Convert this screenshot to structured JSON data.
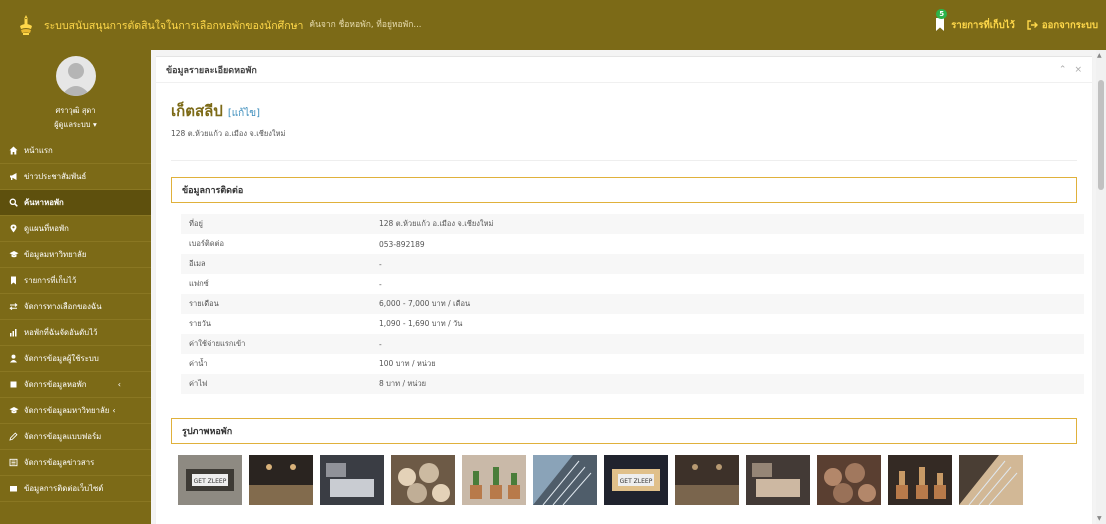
{
  "header": {
    "title": "ระบบสนับสนุนการตัดสินใจในการเลือกหอพักของนักศึกษา",
    "search_placeholder": "ค้นจาก ชื่อหอพัก, ที่อยู่หอพัก...",
    "saved_label": "รายการที่เก็บไว้",
    "saved_count": "5",
    "logout_label": "ออกจากระบบ"
  },
  "colors": {
    "brand": "#7c6a17",
    "accent_text": "#ffd84a",
    "section_border": "#e0b13b",
    "active_menu": "#5e500d"
  },
  "user": {
    "name": "ศราวุฒิ สุดา",
    "role": "ผู้ดูแลระบบ ▾"
  },
  "sidebar": {
    "items": [
      {
        "label": "หน้าแรก",
        "icon": "home-icon"
      },
      {
        "label": "ข่าวประชาสัมพันธ์",
        "icon": "megaphone-icon"
      },
      {
        "label": "ค้นหาหอพัก",
        "icon": "search-icon",
        "active": true
      },
      {
        "label": "ดูแผนที่หอพัก",
        "icon": "map-marker-icon"
      },
      {
        "label": "ข้อมูลมหาวิทยาลัย",
        "icon": "graduation-cap-icon"
      },
      {
        "label": "รายการที่เก็บไว้",
        "icon": "bookmark-icon"
      },
      {
        "label": "จัดการทางเลือกของฉัน",
        "icon": "exchange-icon"
      },
      {
        "label": "หอพักที่ฉันจัดอันดับไว้",
        "icon": "bar-chart-icon"
      },
      {
        "label": "จัดการข้อมูลผู้ใช้ระบบ",
        "icon": "user-icon"
      },
      {
        "label": "จัดการข้อมูลหอพัก",
        "icon": "building-icon",
        "caret": "‹"
      },
      {
        "label": "จัดการข้อมูลมหาวิทยาลัย",
        "icon": "graduation-cap-icon",
        "caret": "‹"
      },
      {
        "label": "จัดการข้อมูลแบบฟอร์ม",
        "icon": "pencil-icon"
      },
      {
        "label": "จัดการข้อมูลข่าวสาร",
        "icon": "newspaper-icon"
      },
      {
        "label": "ข้อมูลการติดต่อเว็บไซต์",
        "icon": "list-icon"
      }
    ]
  },
  "main": {
    "box_title": "ข้อมูลรายละเอียดหอพัก",
    "dorm_name": "เก็ตสลีป",
    "edit_label": "[แก้ไข]",
    "dorm_address": "128 ต.ห้วยแก้ว อ.เมือง จ.เชียงใหม่",
    "contact_title": "ข้อมูลการติดต่อ",
    "contact_rows": [
      {
        "label": "ที่อยู่",
        "value": "128 ต.ห้วยแก้ว อ.เมือง จ.เชียงใหม่"
      },
      {
        "label": "เบอร์ติดต่อ",
        "value": "053-892189"
      },
      {
        "label": "อีเมล",
        "value": "-"
      },
      {
        "label": "แฟกซ์",
        "value": "-"
      },
      {
        "label": "รายเดือน",
        "value": "6,000 - 7,000 บาท / เดือน"
      },
      {
        "label": "รายวัน",
        "value": "1,090 - 1,690 บาท / วัน"
      },
      {
        "label": "ค่าใช้จ่ายแรกเข้า",
        "value": "-"
      },
      {
        "label": "ค่าน้ำ",
        "value": "100 บาท / หน่วย"
      },
      {
        "label": "ค่าไฟ",
        "value": "8 บาท / หน่วย"
      }
    ],
    "photos_title": "รูปภาพหอพัก",
    "photo_sign_text": "GET ZLEEP",
    "photos": [
      {
        "name": "photo-entrance-sign",
        "bg": "#8e8a82",
        "fg": "#3d3a35"
      },
      {
        "name": "photo-lobby-night",
        "bg": "#2a2420",
        "fg": "#d9b27a"
      },
      {
        "name": "photo-room-bed",
        "bg": "#3a3d44",
        "fg": "#c9ccd2"
      },
      {
        "name": "photo-pottery",
        "bg": "#6d5a46",
        "fg": "#e4d2b8"
      },
      {
        "name": "photo-cactus",
        "bg": "#c9b9a8",
        "fg": "#4a7d3a"
      },
      {
        "name": "photo-building-facade",
        "bg": "#8aa3b8",
        "fg": "#4f5d6a"
      },
      {
        "name": "photo-building-night",
        "bg": "#20232e",
        "fg": "#e0c08a"
      },
      {
        "name": "photo-hallway",
        "bg": "#3d3129",
        "fg": "#b89a72"
      },
      {
        "name": "photo-bedroom",
        "bg": "#433a36",
        "fg": "#cdb8a2"
      },
      {
        "name": "photo-brick-corridor",
        "bg": "#5a3f31",
        "fg": "#b3876a"
      },
      {
        "name": "photo-restaurant",
        "bg": "#342a24",
        "fg": "#c89a66"
      },
      {
        "name": "photo-room-interior",
        "bg": "#4a3e34",
        "fg": "#d2b896"
      }
    ]
  }
}
